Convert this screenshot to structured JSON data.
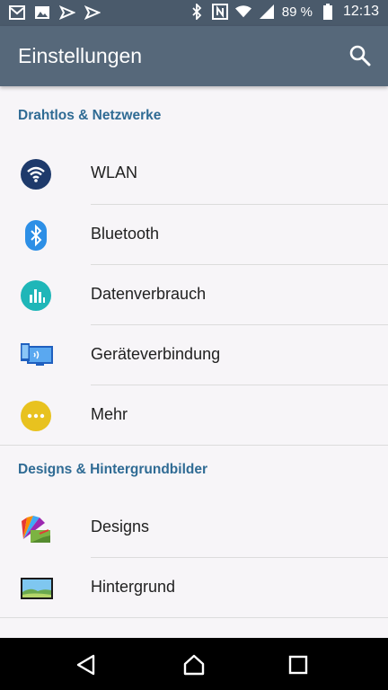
{
  "status_bar": {
    "battery": "89 %",
    "time": "12:13",
    "left_icons": [
      "gmail-icon",
      "image-icon",
      "send-icon",
      "send-icon"
    ],
    "right_icons": [
      "bluetooth-icon",
      "nfc-icon",
      "wifi-icon",
      "signal-icon",
      "battery-icon"
    ]
  },
  "app_bar": {
    "title": "Einstellungen",
    "search_icon": "search-icon"
  },
  "sections": [
    {
      "header": "Drahtlos & Netzwerke",
      "items": [
        {
          "label": "WLAN",
          "icon": "wifi-icon"
        },
        {
          "label": "Bluetooth",
          "icon": "bluetooth-icon"
        },
        {
          "label": "Datenverbrauch",
          "icon": "data-usage-icon"
        },
        {
          "label": "Geräteverbindung",
          "icon": "device-connection-icon"
        },
        {
          "label": "Mehr",
          "icon": "more-icon"
        }
      ]
    },
    {
      "header": "Designs & Hintergrundbilder",
      "items": [
        {
          "label": "Designs",
          "icon": "themes-icon"
        },
        {
          "label": "Hintergrund",
          "icon": "wallpaper-icon"
        }
      ]
    }
  ],
  "nav_bar": {
    "back": "back-icon",
    "home": "home-icon",
    "recents": "recents-icon"
  },
  "colors": {
    "statusbar": "#4a5a6b",
    "appbar": "#56687a",
    "section_header": "#2f6b94",
    "background": "#f7f5f8"
  }
}
